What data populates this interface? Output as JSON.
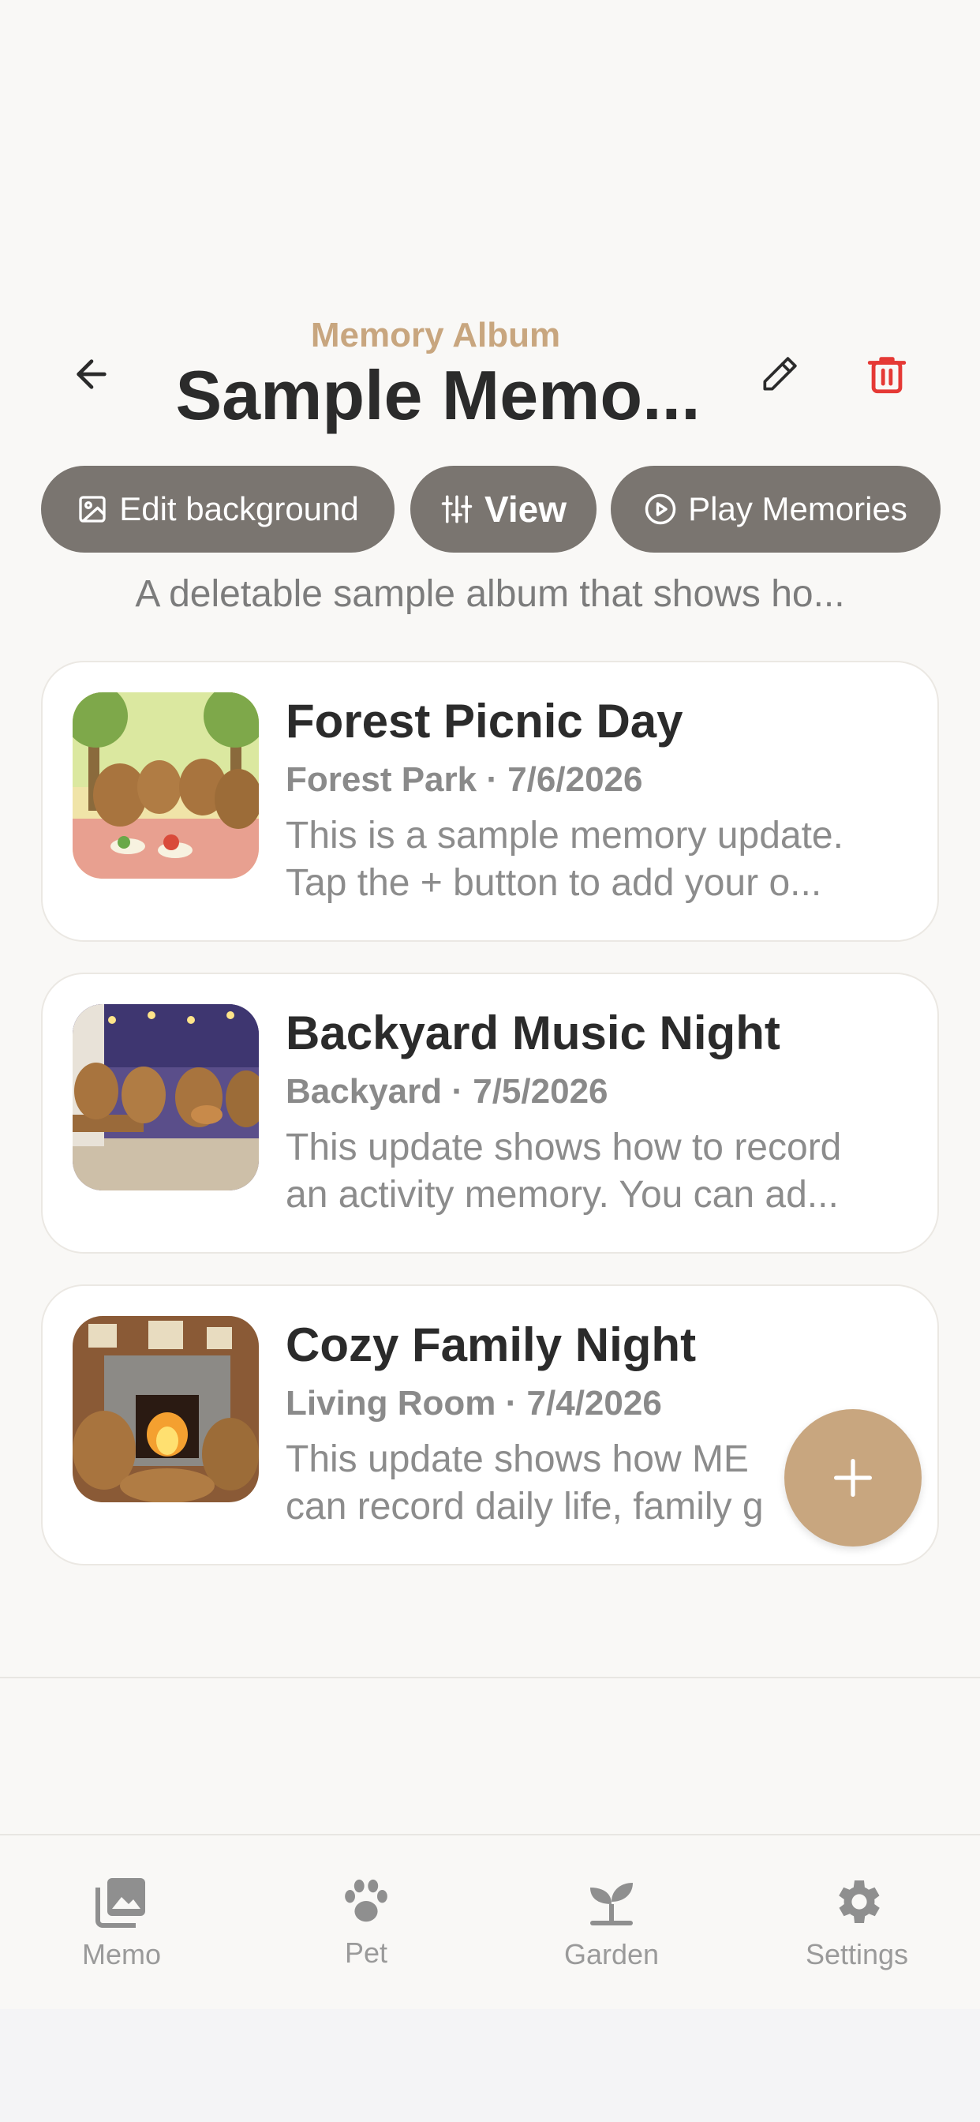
{
  "header": {
    "subtitle": "Memory Album",
    "title": "Sample Memo...",
    "back_icon": "arrow-left-icon",
    "edit_icon": "pencil-icon",
    "delete_icon": "trash-icon"
  },
  "actions": {
    "edit_background": "Edit background",
    "view": "View",
    "play_memories": "Play Memories"
  },
  "description": "A deletable sample album that shows ho...",
  "memories": [
    {
      "title": "Forest Picnic Day",
      "meta": "Forest Park · 7/6/2026",
      "body_line1": "This is a sample memory update.",
      "body_line2": "Tap the + button to add your o..."
    },
    {
      "title": "Backyard Music Night",
      "meta": "Backyard · 7/5/2026",
      "body_line1": "This update shows how to record",
      "body_line2": "an activity memory. You can ad..."
    },
    {
      "title": "Cozy Family Night",
      "meta": "Living Room · 7/4/2026",
      "body_line1": "This update shows how ME",
      "body_line2": "can record daily life, family g"
    }
  ],
  "tabs": [
    {
      "label": "Memo",
      "icon": "photo-gallery-icon"
    },
    {
      "label": "Pet",
      "icon": "paw-icon"
    },
    {
      "label": "Garden",
      "icon": "sprout-icon"
    },
    {
      "label": "Settings",
      "icon": "gear-icon"
    }
  ],
  "colors": {
    "accent": "#c8a67f",
    "pill": "#7a7570",
    "danger": "#e53935",
    "background": "#f9f8f6"
  }
}
